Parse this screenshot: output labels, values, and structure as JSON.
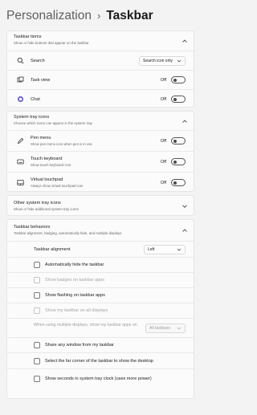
{
  "breadcrumb": {
    "parent": "Personalization",
    "separator": "›",
    "current": "Taskbar"
  },
  "taskbar_items": {
    "title": "Taskbar items",
    "subtitle": "Show or hide buttons that appear on the taskbar",
    "search": {
      "label": "Search",
      "value": "Search icon only"
    },
    "task_view": {
      "label": "Task view",
      "state": "Off"
    },
    "chat": {
      "label": "Chat",
      "state": "Off"
    }
  },
  "system_tray_icons": {
    "title": "System tray icons",
    "subtitle": "Choose which icons can appear in the system tray",
    "pen_menu": {
      "label": "Pen menu",
      "desc": "Show pen menu icon when pen is in use",
      "state": "Off"
    },
    "touch_keyboard": {
      "label": "Touch keyboard",
      "desc": "Show touch keyboard icon",
      "state": "Off"
    },
    "virtual_touchpad": {
      "label": "Virtual touchpad",
      "desc": "Always show virtual touchpad icon",
      "state": "Off"
    }
  },
  "other_tray_icons": {
    "title": "Other system tray icons",
    "subtitle": "Show or hide additional system tray icons"
  },
  "taskbar_behaviors": {
    "title": "Taskbar behaviors",
    "subtitle": "Taskbar alignment, badging, automatically hide, and multiple displays",
    "alignment": {
      "label": "Taskbar alignment",
      "value": "Left"
    },
    "auto_hide": "Automatically hide the taskbar",
    "badges": "Show badges on taskbar apps",
    "flashing": "Show flashing on taskbar apps",
    "all_displays": "Show my taskbar on all displays",
    "multi_display": {
      "label": "When using multiple displays, show my taskbar apps on",
      "value": "All taskbars"
    },
    "share_window": "Share any window from my taskbar",
    "far_corner": "Select the far corner of the taskbar to show the desktop",
    "show_seconds": "Show seconds in system tray clock (uses more power)"
  }
}
